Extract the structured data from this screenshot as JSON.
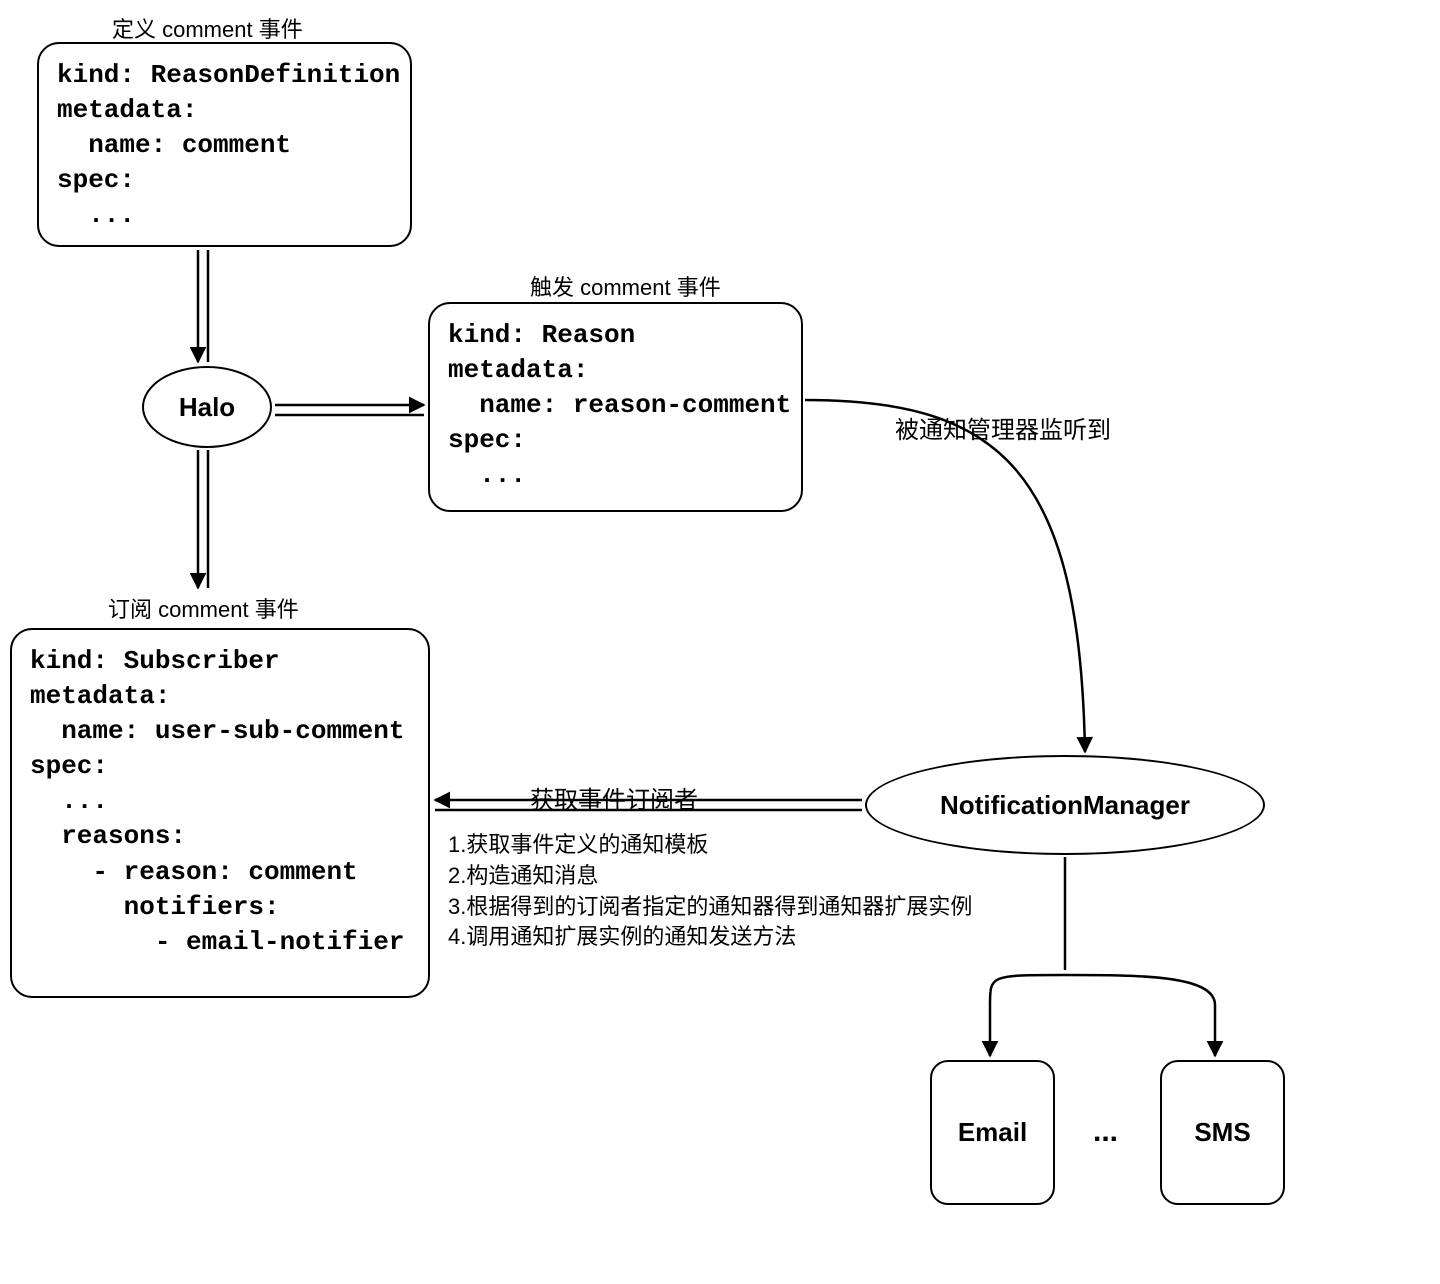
{
  "boxes": {
    "definition": {
      "title": "定义 comment 事件",
      "code": "kind: ReasonDefinition\nmetadata:\n  name: comment\nspec:\n  ..."
    },
    "trigger": {
      "title": "触发 comment 事件",
      "code": "kind: Reason\nmetadata:\n  name: reason-comment\nspec:\n  ..."
    },
    "subscriber": {
      "title": "订阅 comment 事件",
      "code": "kind: Subscriber\nmetadata:\n  name: user-sub-comment\nspec:\n  ...\n  reasons:\n    - reason: comment\n      notifiers:\n        - email-notifier"
    }
  },
  "nodes": {
    "halo": "Halo",
    "manager": "NotificationManager",
    "email": "Email",
    "sms": "SMS",
    "ellipsis": "..."
  },
  "labels": {
    "listened": "被通知管理器监听到",
    "get_subscribers": "获取事件订阅者"
  },
  "steps_text": "1.获取事件定义的通知模板\n2.构造通知消息\n3.根据得到的订阅者指定的通知器得到通知器扩展实例\n4.调用通知扩展实例的通知发送方法"
}
